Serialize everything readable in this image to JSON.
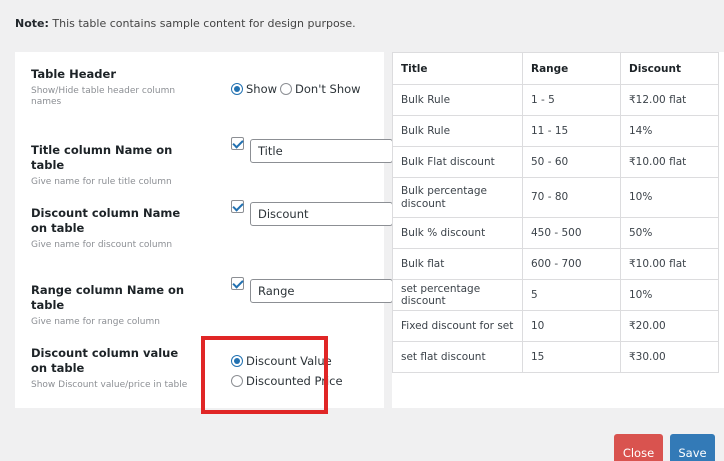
{
  "note": {
    "label": "Note:",
    "text": " This table contains sample content for design purpose."
  },
  "settings": {
    "table_header": {
      "title": "Table Header",
      "desc": "Show/Hide table header column names",
      "opt_show": "Show",
      "opt_dont_show": "Don't Show",
      "selected": "Show"
    },
    "title_column": {
      "title": "Title column Name on table",
      "desc": "Give name for rule title column",
      "checked": true,
      "value": "Title"
    },
    "discount_column": {
      "title": "Discount column Name on table",
      "desc": "Give name for discount column",
      "checked": true,
      "value": "Discount"
    },
    "range_column": {
      "title": "Range column Name on table",
      "desc": "Give name for range column",
      "checked": true,
      "value": "Range"
    },
    "discount_value": {
      "title": "Discount column value on table",
      "desc": "Show Discount value/price in table",
      "opt_value": "Discount Value",
      "opt_price": "Discounted Price",
      "selected": "Discount Value"
    }
  },
  "preview_table": {
    "headers": [
      "Title",
      "Range",
      "Discount"
    ],
    "rows": [
      [
        "Bulk Rule",
        "1 - 5",
        "₹12.00 flat"
      ],
      [
        "Bulk Rule",
        "11 - 15",
        "14%"
      ],
      [
        "Bulk Flat discount",
        "50 - 60",
        "₹10.00 flat"
      ],
      [
        "Bulk percentage discount",
        "70 - 80",
        "10%"
      ],
      [
        "Bulk % discount",
        "450 - 500",
        "50%"
      ],
      [
        "Bulk flat",
        "600 - 700",
        "₹10.00 flat"
      ],
      [
        "set percentage discount",
        "5",
        "10%"
      ],
      [
        "Fixed discount for set",
        "10",
        "₹20.00"
      ],
      [
        "set flat discount",
        "15",
        "₹30.00"
      ]
    ]
  },
  "buttons": {
    "close": "Close",
    "save": "Save"
  },
  "colors": {
    "accent": "#2271b1",
    "close": "#d9534f",
    "save": "#337ab7",
    "highlight": "#e02626"
  }
}
